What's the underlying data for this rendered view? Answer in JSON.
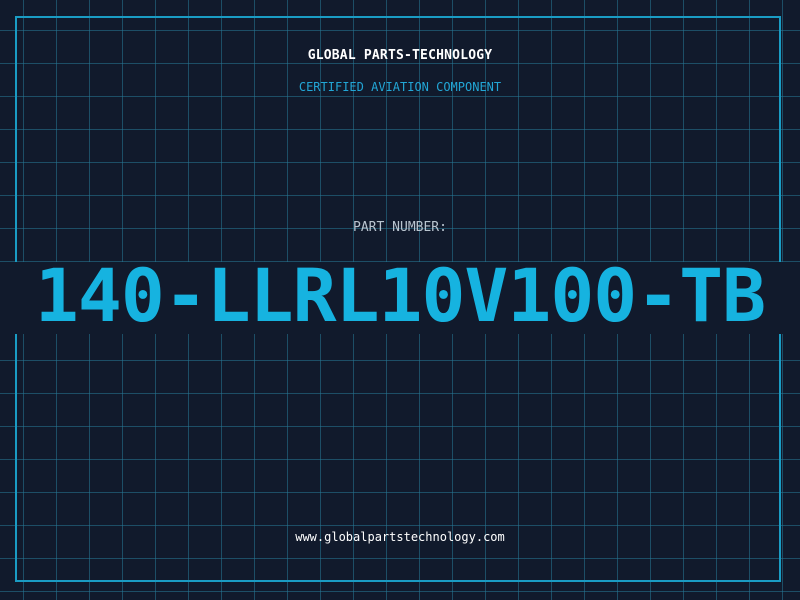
{
  "header": {
    "company": "GLOBAL PARTS-TECHNOLOGY",
    "tagline": "CERTIFIED AVIATION COMPONENT"
  },
  "part": {
    "label": "PART NUMBER:",
    "number": "140-LLRL10V100-TB"
  },
  "footer": {
    "website": "www.globalpartstechnology.com"
  },
  "colors": {
    "background": "#111a2c",
    "grid": "#26788c",
    "accent": "#16b3e0",
    "frame": "#1a9cc4"
  }
}
